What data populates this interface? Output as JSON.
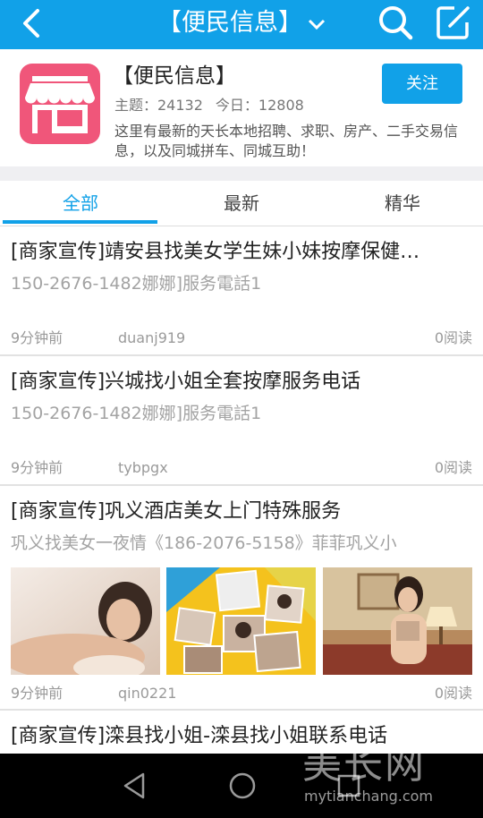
{
  "topbar": {
    "title": "【便民信息】",
    "back_icon": "back-arrow-icon",
    "search_icon": "search-icon",
    "edit_icon": "compose-icon",
    "background": "#11a1e8"
  },
  "forum": {
    "name": "【便民信息】",
    "topics_label": "主题：24132",
    "today_label": "今日：12808",
    "description": "这里有最新的天长本地招聘、求职、房产、二手交易信息，以及同城拼车、同城互助！",
    "follow_label": "关注",
    "logo_icon": "storefront-icon",
    "logo_color": "#f0567a"
  },
  "tabs": [
    {
      "label": "全部",
      "active": true
    },
    {
      "label": "最新",
      "active": false
    },
    {
      "label": "精华",
      "active": false
    }
  ],
  "posts": [
    {
      "title": "[商家宣传]靖安县找美女学生妹小妹按摩保健…",
      "subtitle": "150-2676-1482娜娜]服务電話1",
      "time": "9分钟前",
      "author": "duanj919",
      "reads": "0阅读"
    },
    {
      "title": "[商家宣传]兴城找小姐全套按摩服务电话",
      "subtitle": "150-2676-1482娜娜]服务電話1",
      "time": "9分钟前",
      "author": "tybpgx",
      "reads": "0阅读"
    },
    {
      "title": "[商家宣传]巩义酒店美女上门特殊服务",
      "subtitle": "巩义找美女一夜情《186-2076-5158》菲菲巩义小",
      "time": "9分钟前",
      "author": "qin0221",
      "reads": "0阅读",
      "images": [
        "photo-thumbnail-1",
        "photo-collage-thumbnail",
        "photo-thumbnail-3"
      ]
    },
    {
      "title": "[商家宣传]滦县找小姐-滦县找小姐联系电话"
    }
  ],
  "navbar": {
    "back_icon": "nav-back-icon",
    "home_icon": "nav-home-icon",
    "recents_icon": "nav-recents-icon"
  },
  "watermark": {
    "big": "美长网",
    "small": "mytianchang.com"
  }
}
